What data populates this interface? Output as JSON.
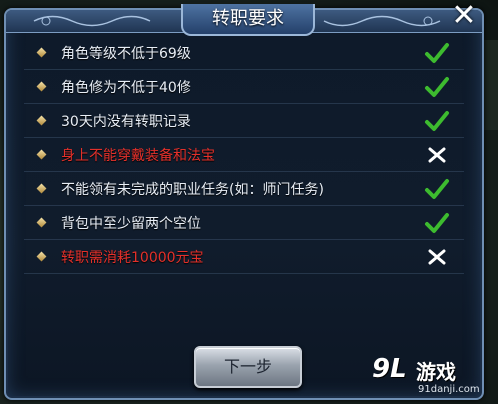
{
  "dialog": {
    "title": "转职要求",
    "close_label": "✕",
    "next_label": "下一步"
  },
  "requirements": [
    {
      "text": "角色等级不低于69级",
      "met": true
    },
    {
      "text": "角色修为不低于40修",
      "met": true
    },
    {
      "text": "30天内没有转职记录",
      "met": true
    },
    {
      "text": "身上不能穿戴装备和法宝",
      "met": false
    },
    {
      "text": "不能领有未完成的职业任务(如：师门任务)",
      "met": true
    },
    {
      "text": "背包中至少留两个空位",
      "met": true
    },
    {
      "text": "转职需消耗10000元宝",
      "met": false
    }
  ],
  "icons": {
    "met": "check-icon",
    "unmet": "cross-icon",
    "bullet": "diamond-bullet-icon"
  },
  "colors": {
    "met": "#3dbb2f",
    "unmet": "#ffffff",
    "fail_text": "#e3302a",
    "normal_text": "#e8eef6"
  },
  "watermark": {
    "logo": "9L",
    "name": "游戏",
    "url": "91danji.com"
  }
}
